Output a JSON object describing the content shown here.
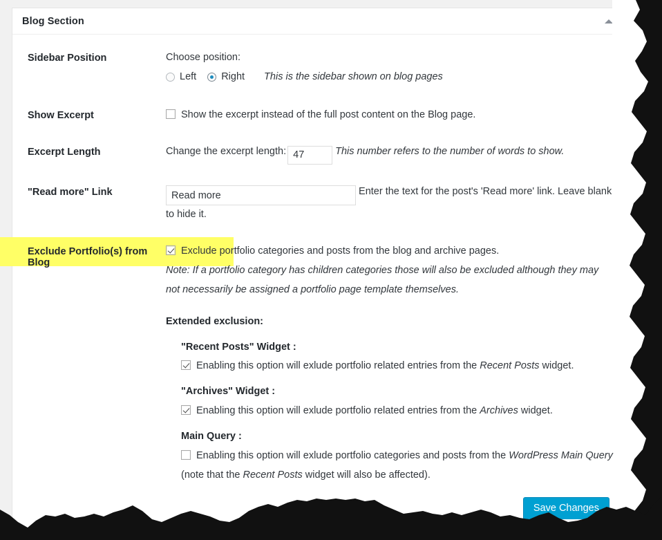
{
  "panel": {
    "title": "Blog Section",
    "toggle_icon": "chevron-up-icon"
  },
  "rows": {
    "sidebar_position": {
      "label": "Sidebar Position",
      "choose_label": "Choose position:",
      "options": [
        {
          "label": "Left",
          "checked": false
        },
        {
          "label": "Right",
          "checked": true
        }
      ],
      "hint": "This is the sidebar shown on blog pages"
    },
    "show_excerpt": {
      "label": "Show Excerpt",
      "checkbox_checked": false,
      "description": "Show the excerpt instead of the full post content on the Blog page."
    },
    "excerpt_length": {
      "label": "Excerpt Length",
      "field_label": "Change the excerpt length:",
      "value": "47",
      "hint": "This number refers to the number of words to show."
    },
    "read_more": {
      "label": "\"Read more\" Link",
      "value": "Read more",
      "hint": "Enter the text for the post's 'Read more' link. Leave blank to hide it."
    },
    "exclude_portfolio": {
      "label": "Exclude Portfolio(s) from Blog",
      "highlighted": true,
      "checkbox_checked": true,
      "description": "Exclude portfolio categories and posts from the blog and archive pages.",
      "note": "Note: If a portfolio category has children categories those will also be excluded although they may not necessarily be assigned a portfolio page template themselves.",
      "extended_title": "Extended exclusion:",
      "groups": [
        {
          "title": "\"Recent Posts\" Widget :",
          "checked": true,
          "desc_before": "Enabling this option will exlude portfolio related entries from the ",
          "desc_em": "Recent Posts",
          "desc_after": " widget."
        },
        {
          "title": "\"Archives\" Widget :",
          "checked": true,
          "desc_before": "Enabling this option will exlude portfolio related entries from the ",
          "desc_em": "Archives",
          "desc_after": " widget."
        },
        {
          "title": "Main Query :",
          "checked": false,
          "desc_before": "Enabling this option will exlude portfolio categories and posts from the ",
          "desc_em": "WordPress Main Query",
          "desc_after": " (note that the ",
          "desc_em2": "Recent Posts",
          "desc_after2": " widget will also be affected)."
        }
      ]
    }
  },
  "footer": {
    "save_label": "Save Changes"
  },
  "colors": {
    "accent_blue": "#00a0d2",
    "highlight_yellow": "#ffff66",
    "page_background": "#f1f1f1",
    "text": "#23282d"
  }
}
